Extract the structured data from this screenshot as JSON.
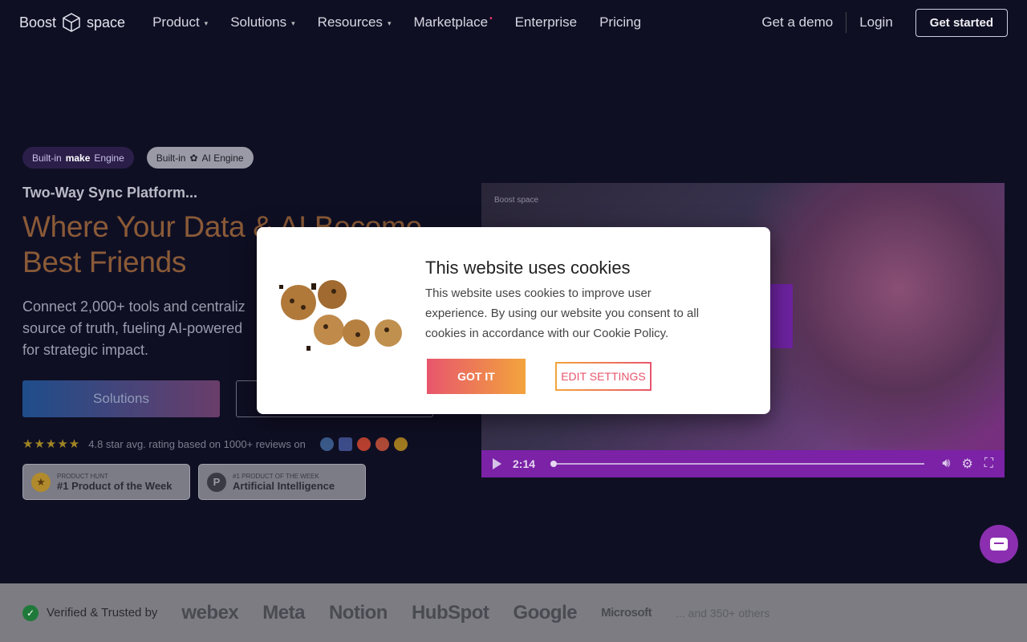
{
  "nav": {
    "logo_left": "Boost",
    "logo_right": "space",
    "links": [
      {
        "label": "Product",
        "has_caret": true
      },
      {
        "label": "Solutions",
        "has_caret": true
      },
      {
        "label": "Resources",
        "has_caret": true
      },
      {
        "label": "Marketplace",
        "has_caret": false,
        "dot": "•"
      },
      {
        "label": "Enterprise",
        "has_caret": false
      },
      {
        "label": "Pricing",
        "has_caret": false
      }
    ],
    "demo": "Get a demo",
    "login": "Login",
    "cta": "Get started"
  },
  "hero": {
    "badge_make_prefix": "Built-in",
    "badge_make_brand": "make",
    "badge_make_suffix": "Engine",
    "badge_ai_prefix": "Built-in",
    "badge_ai_suffix": "AI Engine",
    "eyebrow": "Two-Way Sync Platform...",
    "headline_1": "Where Your Data & AI Become",
    "headline_2": "Best Friends",
    "subline": "Connect 2,000+ tools and centraliz source of truth, fueling AI-powered for strategic impact.",
    "solutions_button": "Solutions",
    "stars": "★★★★★",
    "rating_text": "4.8 star avg. rating based on 1000+ reviews on",
    "awards": [
      {
        "small": "PRODUCT HUNT",
        "big": "#1 Product of the Week",
        "icon": "medal"
      },
      {
        "small": "#1 PRODUCT OF THE WEEK",
        "big": "Artificial Intelligence",
        "icon": "P"
      }
    ]
  },
  "video": {
    "logo": "Boost space",
    "time": "2:14",
    "progress": 0.0
  },
  "cookie_dialog": {
    "title": "This website uses cookies",
    "text": "This website uses cookies to improve user experience. By using our website you consent to all cookies in accordance with our Cookie Policy.",
    "accept": "GOT IT",
    "settings": "EDIT SETTINGS"
  },
  "trust": {
    "verified": "Verified & Trusted by",
    "brands": [
      "webex",
      "Meta",
      "Notion",
      "HubSpot",
      "Google",
      "Microsoft"
    ],
    "others": "... and 350+ others"
  },
  "colors": {
    "accent_orange": "#f2a43c",
    "accent_pink": "#e8566d",
    "video_purple": "#7b22a6",
    "chat_purple": "#8b2fb0"
  }
}
